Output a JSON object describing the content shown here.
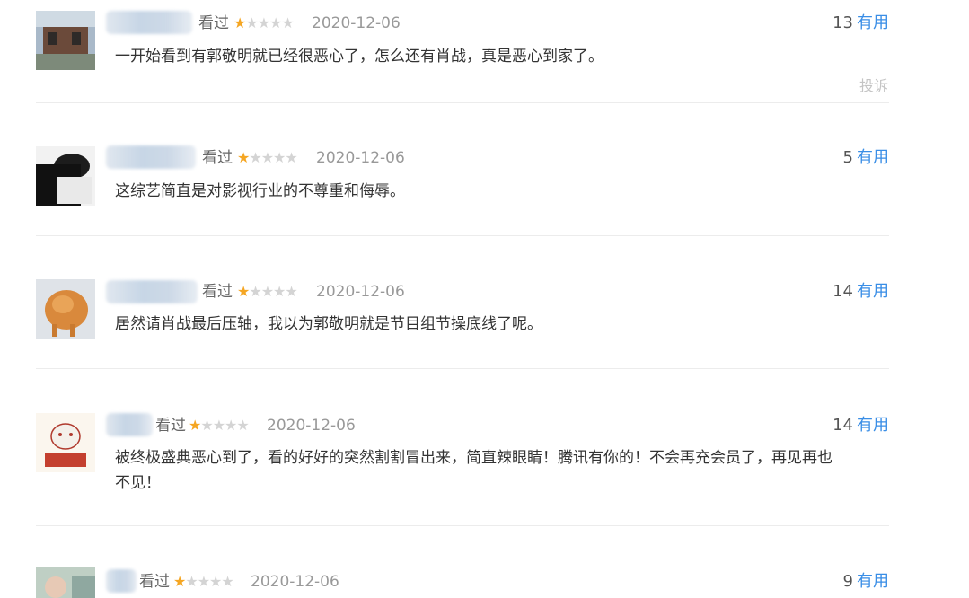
{
  "comments": [
    {
      "status": "看过",
      "rating": 1,
      "stars_max": 5,
      "date": "2020-12-06",
      "votes": "13",
      "useful_label": "有用",
      "content": "一开始看到有郭敬明就已经很恶心了，怎么还有肖战，真是恶心到家了。",
      "report_label": "投诉"
    },
    {
      "status": "看过",
      "rating": 1,
      "stars_max": 5,
      "date": "2020-12-06",
      "votes": "5",
      "useful_label": "有用",
      "content": "这综艺简直是对影视行业的不尊重和侮辱。"
    },
    {
      "status": "看过",
      "rating": 1,
      "stars_max": 5,
      "date": "2020-12-06",
      "votes": "14",
      "useful_label": "有用",
      "content": "居然请肖战最后压轴，我以为郭敬明就是节目组节操底线了呢。"
    },
    {
      "status": "看过",
      "rating": 1,
      "stars_max": 5,
      "date": "2020-12-06",
      "votes": "14",
      "useful_label": "有用",
      "content_line1": "被终极盛典恶心到了，看的好好的突然割割冒出来，简直辣眼睛！腾讯有你的！不会再充会员了，再见再也",
      "content_line2": "不见！"
    },
    {
      "status": "看过",
      "rating": 1,
      "stars_max": 5,
      "date": "2020-12-06",
      "votes": "9",
      "useful_label": "有用"
    }
  ],
  "colors": {
    "star_on": "#f5a623",
    "star_off": "#d4d4d4",
    "link": "#3a8ee6"
  },
  "icons": {
    "star": "★"
  }
}
